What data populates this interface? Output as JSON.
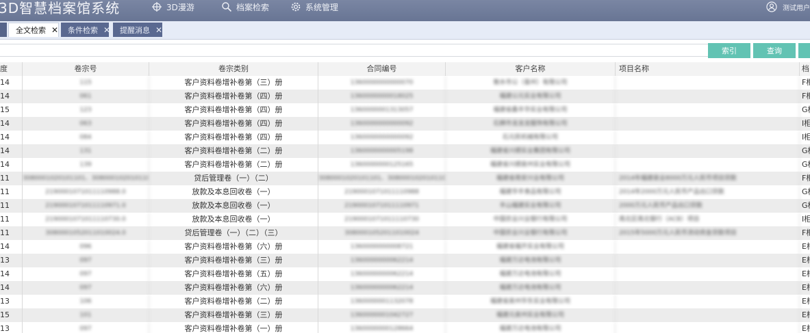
{
  "app": {
    "title": "3D智慧档案馆系统",
    "user": "测试用户"
  },
  "nav": [
    {
      "label": "3D漫游",
      "icon": "roam-icon"
    },
    {
      "label": "档案检索",
      "icon": "search-icon"
    },
    {
      "label": "系统管理",
      "icon": "gear-icon"
    }
  ],
  "tabs": [
    {
      "label": "全文检索",
      "active": true
    },
    {
      "label": "条件检索",
      "active": false
    },
    {
      "label": "提醒消息",
      "active": false
    }
  ],
  "search": {
    "placeholder": "",
    "value": "",
    "index_label": "索引",
    "query_label": "查询"
  },
  "table": {
    "headers": [
      "度",
      "卷宗号",
      "卷宗类别",
      "合同编号",
      "客户名称",
      "项目名称",
      "档"
    ],
    "rows": [
      [
        "14",
        "115",
        "客户资料卷增补卷第（三）册",
        "1360000000000070",
        "衡水市公（泰州）有限公司",
        "",
        "F柜"
      ],
      [
        "14",
        "061",
        "客户资料卷增补卷第（四）册",
        "1360000000018025",
        "福建公元实业有限公司",
        "",
        "F柜"
      ],
      [
        "15",
        "123",
        "客户资料卷增补卷第（四）册",
        "1360000001313057",
        "福建省鑫丰华实业有限公司",
        "",
        "G柜"
      ],
      [
        "14",
        "063",
        "客户资料卷增补卷第（四）册",
        "1360000000000092",
        "石狮市龙龙龙服饰有限公司",
        "",
        "I柜"
      ],
      [
        "14",
        "084",
        "客户资料卷增补卷第（四）册",
        "1360000000000092",
        "石元民机械有限公司",
        "",
        "I柜"
      ],
      [
        "14",
        "131",
        "客户资料卷增补卷第（二）册",
        "1360000000005198",
        "福建省兴顺实业集团有限公司",
        "",
        "G柜"
      ],
      [
        "14",
        "139",
        "客户资料卷增补卷第（二）册",
        "1360000000125165",
        "福建省兴顺泉州实业有限公司",
        "",
        "G柜"
      ],
      [
        "11",
        "3080001020101101、3080001020101102",
        "贷后管理卷（一）（二）",
        "3080001020101101、3080001020101102",
        "福建省南安兴业有限公司",
        "2014年福建泉业8000万元人民币项目贷款",
        "F柜"
      ],
      [
        "11",
        "2190001071011110988.0",
        "放款及本息回收卷（一）",
        "2190001071011110988",
        "福建华丰食品有限公司",
        "2014年2000万元人民币产品出口贷款",
        "G柜"
      ],
      [
        "11",
        "2190001071011110971.0",
        "放款及本息回收卷（一）",
        "2190001071011110971",
        "丰山福建实业有限公司",
        "2000万元人民币产品出口贷款",
        "G柜"
      ],
      [
        "11",
        "2190001071011110730.0",
        "放款及本息回收卷（一）",
        "2190001071011110730",
        "中国农业兴业银行有限公司",
        "南北区南北银行（ACB）项目",
        "I柜"
      ],
      [
        "11",
        "3080001052011010024.0",
        "贷后管理卷（一）（二）（三）",
        "3080001052011010024",
        "中国农业兴业银行有限公司",
        "2015年5000万元人民币流动资金贷款项目",
        "F柜"
      ],
      [
        "14",
        "096",
        "客户资料卷增补卷第（六）册",
        "1360000000008721",
        "福建省福开实业有限公司",
        "",
        "E柜"
      ],
      [
        "13",
        "097",
        "客户资料卷增补卷第（三）册",
        "1360000000062214",
        "福建万达电池有限公司",
        "",
        "E柜"
      ],
      [
        "14",
        "097",
        "客户资料卷增补卷第（五）册",
        "1360000000062214",
        "福建万达电池有限公司",
        "",
        "E柜"
      ],
      [
        "14",
        "097",
        "客户资料卷增补卷第（六）册",
        "1360000000062214",
        "福建万达电池有限公司",
        "",
        "E柜"
      ],
      [
        "13",
        "106",
        "客户资料卷增补卷第（二）册",
        "1360000001132078",
        "福建省泉州华东实业有限公司",
        "",
        "E柜"
      ],
      [
        "15",
        "101",
        "客户资料卷增补卷第（三）册",
        "1360000001042727",
        "福建元泉州实业有限公司",
        "",
        "E柜"
      ],
      [
        "13",
        "097",
        "客户资料卷增补卷第（一）册",
        "1360000000128664",
        "福建万达电池有限公司",
        "",
        "E柜"
      ]
    ]
  },
  "colors": {
    "topbar": "#6f7b99",
    "accent": "#62c3b3",
    "tab_inactive": "#5a6990",
    "row_alt": "#ececec"
  }
}
